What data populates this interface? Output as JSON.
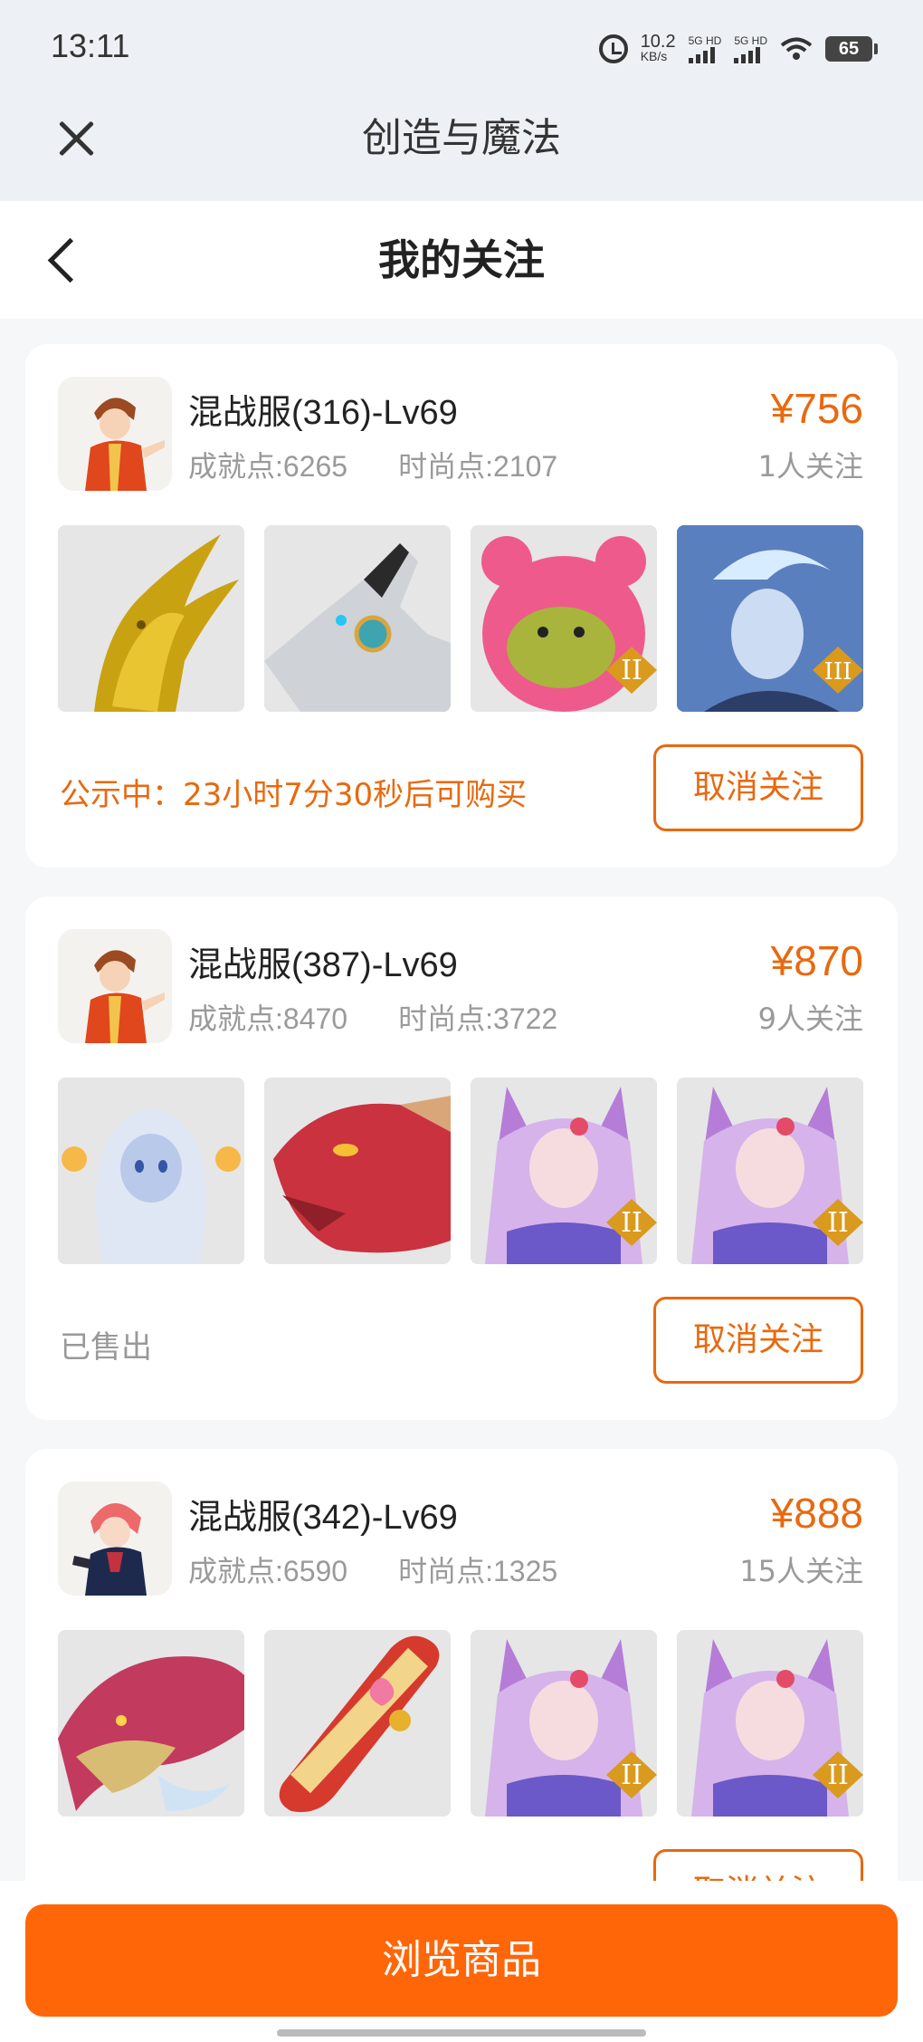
{
  "status_bar": {
    "time": "13:11",
    "net_speed_value": "10.2",
    "net_speed_unit": "KB/s",
    "sim1_label": "5G HD",
    "sim2_label": "5G HD",
    "battery": "65"
  },
  "header": {
    "title": "创造与魔法",
    "close_icon": "close-icon"
  },
  "page": {
    "title": "我的关注",
    "back_icon": "back-arrow-icon"
  },
  "items": [
    {
      "server": "混战服(316)-Lv69",
      "achievement": "成就点:6265",
      "fashion": "时尚点:2107",
      "price": "¥756",
      "followers": "1人关注",
      "status": "公示中：23小时7分30秒后可购买",
      "action": "取消关注"
    },
    {
      "server": "混战服(387)-Lv69",
      "achievement": "成就点:8470",
      "fashion": "时尚点:3722",
      "price": "¥870",
      "followers": "9人关注",
      "status": "已售出",
      "action": "取消关注"
    },
    {
      "server": "混战服(342)-Lv69",
      "achievement": "成就点:6590",
      "fashion": "时尚点:1325",
      "price": "¥888",
      "followers": "15人关注",
      "status": "",
      "action": "取消关注"
    }
  ],
  "bottom": {
    "browse_label": "浏览商品"
  },
  "colors": {
    "accent": "#ff6608",
    "price": "#e8690f"
  }
}
